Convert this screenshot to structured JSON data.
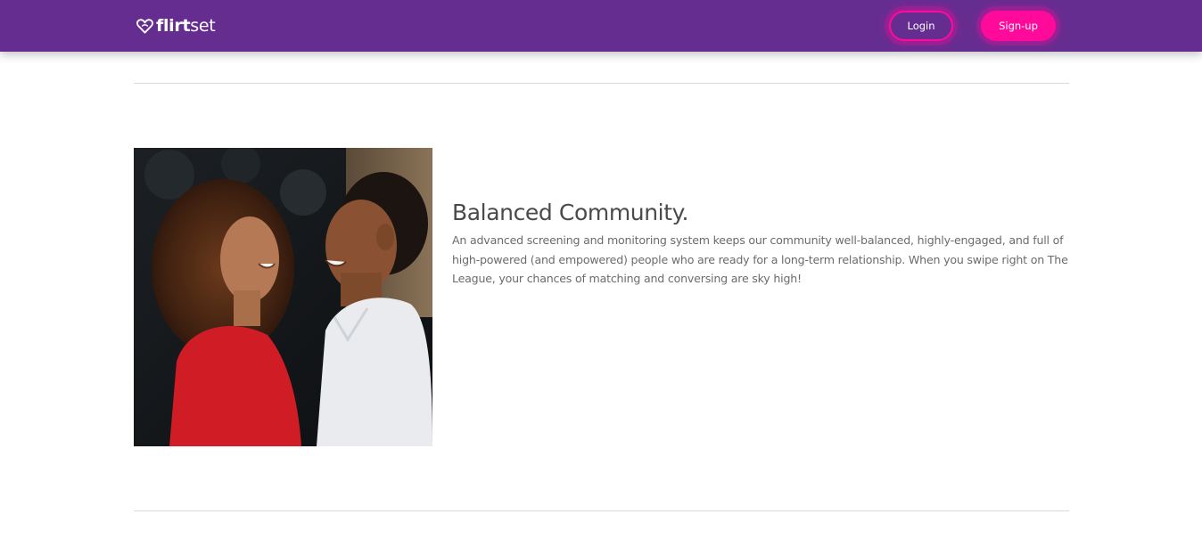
{
  "navbar": {
    "brand_bold": "flirt",
    "brand_thin": "set",
    "login_label": "Login",
    "signup_label": "Sign-up"
  },
  "feature": {
    "image_alt": "Smiling couple facing each other",
    "title": "Balanced Community.",
    "body": "An advanced screening and monitoring system keeps our community well-balanced, highly-engaged, and full of high-powered (and empowered) people who are ready for a long-term relationship. When you swipe right on The League, your chances of matching and conversing are sky high!"
  },
  "colors": {
    "navbar_bg": "#662d91",
    "accent_pink": "#ff0a9a",
    "divider": "#d9d9d9",
    "title_text": "#4a4a4a",
    "body_text": "#6b6b6b"
  }
}
